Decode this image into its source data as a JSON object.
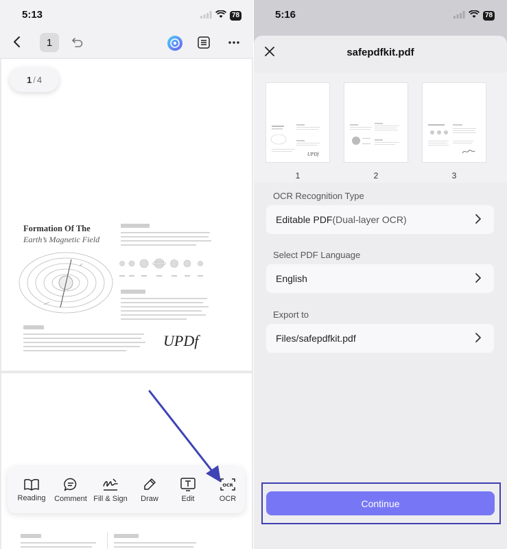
{
  "left": {
    "status": {
      "time": "5:13",
      "battery": "78"
    },
    "toolbar": {
      "back_icon": "chevron-left-icon",
      "page_number": "1",
      "undo_icon": "undo-icon",
      "ai_icon": "ai-assistant-icon",
      "outline_icon": "outline-list-icon",
      "more_icon": "more-dots-icon"
    },
    "page_counter": {
      "current": "1",
      "total": "4"
    },
    "document": {
      "title": "Formation Of The",
      "subtitle": "Earth’s Magnetic Field",
      "logo": "UPDf"
    },
    "bottom_tools": [
      {
        "label": "Reading",
        "icon": "book-icon"
      },
      {
        "label": "Comment",
        "icon": "comment-icon"
      },
      {
        "label": "Fill & Sign",
        "icon": "signature-icon"
      },
      {
        "label": "Draw",
        "icon": "pen-icon"
      },
      {
        "label": "Edit",
        "icon": "text-edit-icon"
      },
      {
        "label": "OCR",
        "icon": "ocr-icon"
      }
    ]
  },
  "right": {
    "status": {
      "time": "5:16",
      "battery": "78"
    },
    "sheet": {
      "title": "safepdfkit.pdf",
      "thumbnails": [
        "1",
        "2",
        "3"
      ],
      "ocr_type_label": "OCR Recognition Type",
      "ocr_type_value": "Editable PDF",
      "ocr_type_detail": "(Dual-layer OCR)",
      "language_label": "Select PDF Language",
      "language_value": "English",
      "export_label": "Export to",
      "export_value": "Files/safepdfkit.pdf",
      "continue_label": "Continue"
    }
  },
  "colors": {
    "accent": "#7777f6",
    "highlight_frame": "#3f3fb0",
    "annotation_arrow": "#3e43b5"
  }
}
